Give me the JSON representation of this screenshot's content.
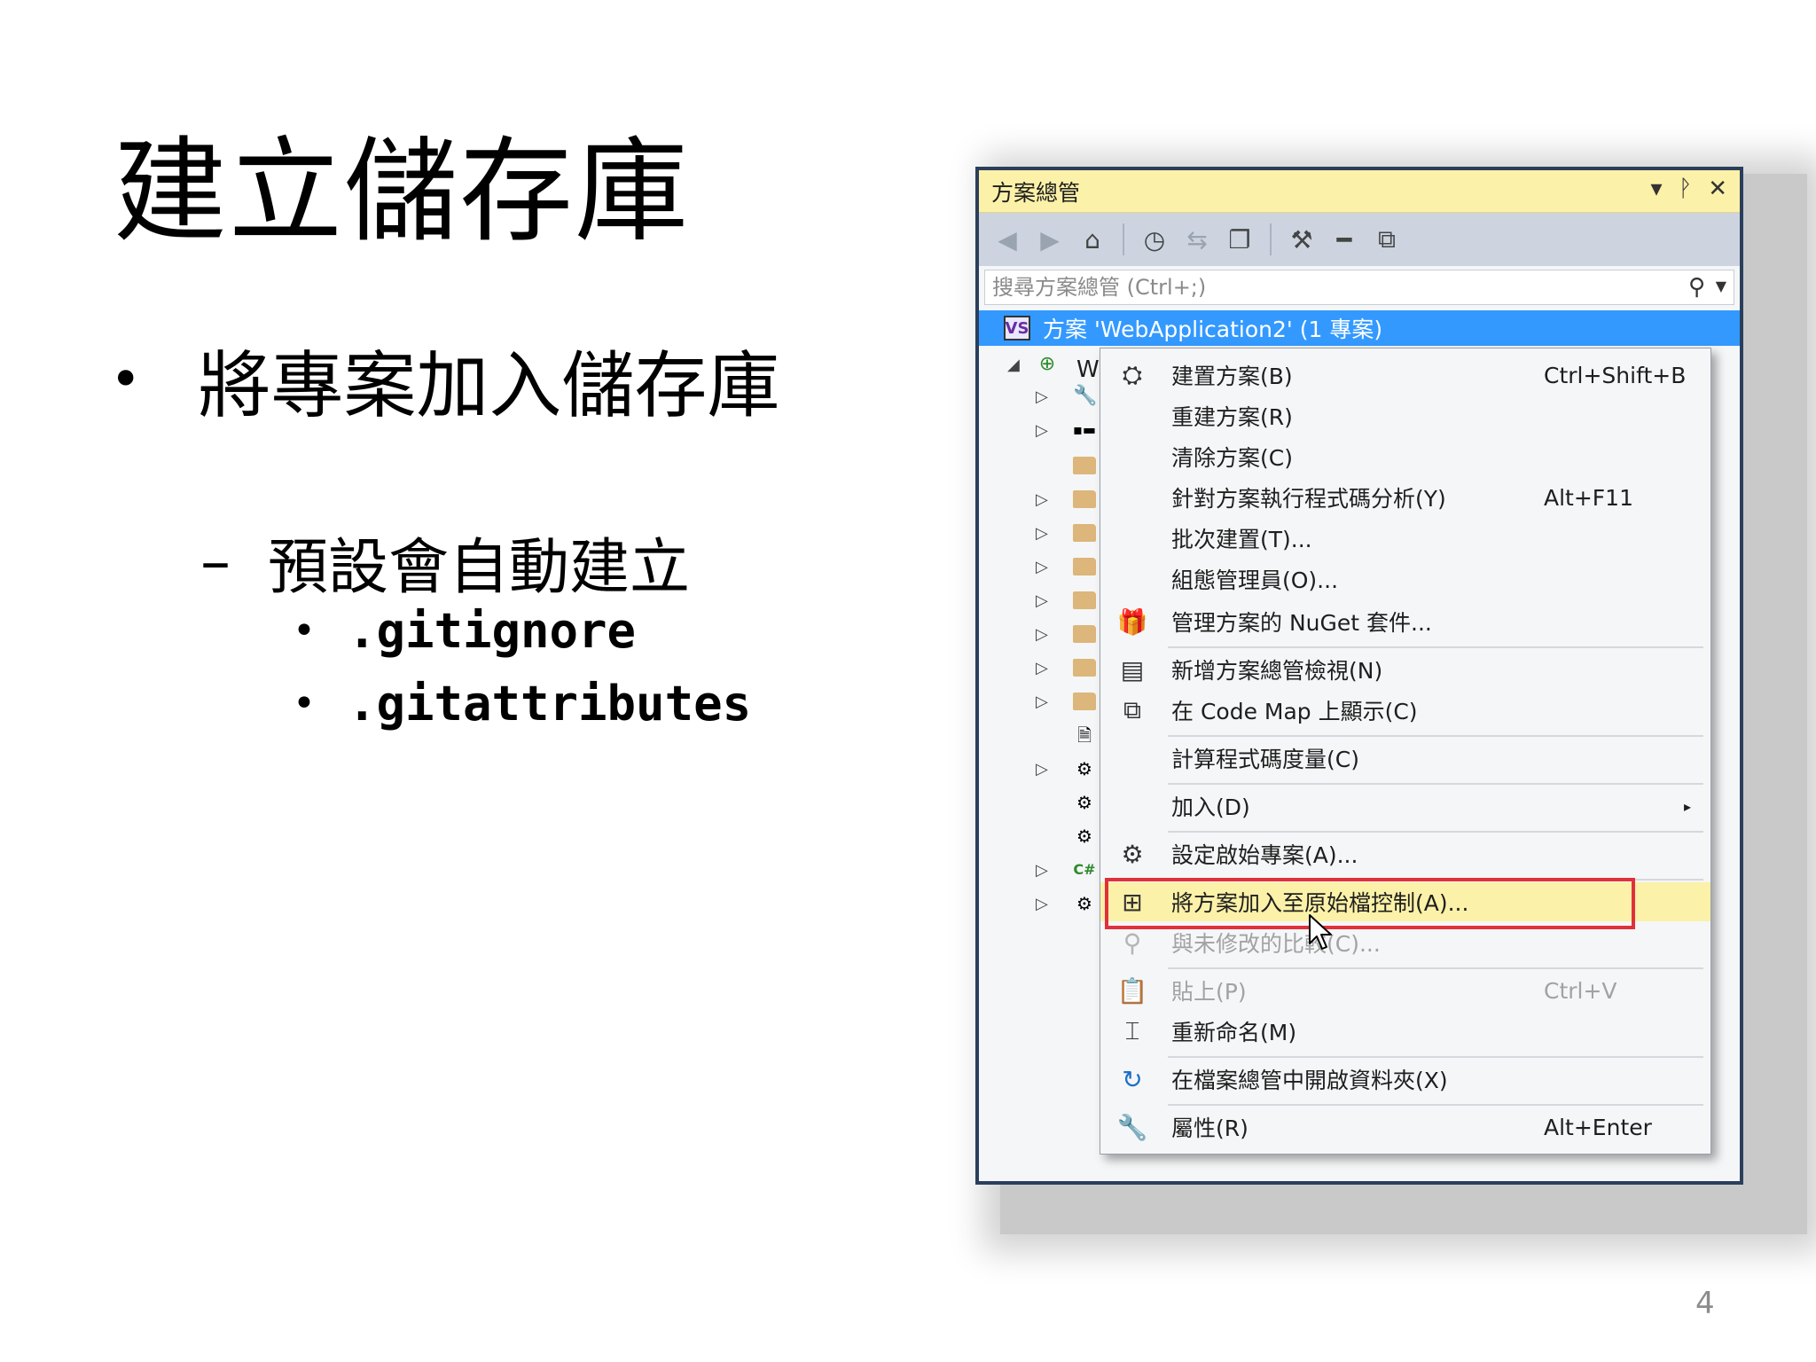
{
  "slide": {
    "title": "建立儲存庫",
    "bullet1": "將專案加入儲存庫",
    "bullet2": "預設會自動建立",
    "bullet3a": ".gitignore",
    "bullet3b": ".gitattributes",
    "page_number": "4",
    "bullet_glyph": "•",
    "dash_glyph": "–"
  },
  "solution_explorer": {
    "title": "方案總管",
    "title_buttons": {
      "dropdown": "▾",
      "pin": "ᚹ",
      "close": "✕"
    },
    "search_placeholder": "搜尋方案總管 (Ctrl+;)",
    "root_label": "方案 'WebApplication2' (1 專案)",
    "project_label_partial": "W",
    "toolbar_icons": [
      "back-icon",
      "forward-icon",
      "home-icon",
      "history-icon",
      "sync-icon",
      "collapse-all-icon",
      "properties-icon",
      "pending-changes-icon",
      "code-map-icon"
    ],
    "tree_rows": [
      {
        "icon": "web-project-icon",
        "expander": "open"
      },
      {
        "icon": "wrench-icon",
        "expander": "closed"
      },
      {
        "icon": "references-icon",
        "expander": "closed"
      },
      {
        "icon": "folder-icon",
        "expander": "none"
      },
      {
        "icon": "folder-icon",
        "expander": "closed"
      },
      {
        "icon": "folder-icon",
        "expander": "closed"
      },
      {
        "icon": "folder-icon",
        "expander": "closed"
      },
      {
        "icon": "folder-icon",
        "expander": "closed"
      },
      {
        "icon": "folder-icon",
        "expander": "closed"
      },
      {
        "icon": "folder-icon",
        "expander": "closed"
      },
      {
        "icon": "folder-icon",
        "expander": "closed"
      },
      {
        "icon": "file-icon",
        "expander": "none"
      },
      {
        "icon": "config-file-icon",
        "expander": "closed"
      },
      {
        "icon": "config-file-icon",
        "expander": "none"
      },
      {
        "icon": "config-file-icon",
        "expander": "none"
      },
      {
        "icon": "csharp-file-icon",
        "expander": "closed"
      },
      {
        "icon": "config-file-icon",
        "expander": "closed"
      }
    ]
  },
  "context_menu": {
    "items": [
      {
        "icon": "build-icon",
        "label": "建置方案(B)",
        "shortcut": "Ctrl+Shift+B"
      },
      {
        "icon": "",
        "label": "重建方案(R)",
        "shortcut": ""
      },
      {
        "icon": "",
        "label": "清除方案(C)",
        "shortcut": ""
      },
      {
        "icon": "",
        "label": "針對方案執行程式碼分析(Y)",
        "shortcut": "Alt+F11"
      },
      {
        "icon": "",
        "label": "批次建置(T)...",
        "shortcut": ""
      },
      {
        "icon": "",
        "label": "組態管理員(O)...",
        "shortcut": ""
      },
      {
        "icon": "nuget-icon",
        "label": "管理方案的 NuGet 套件...",
        "shortcut": ""
      },
      {
        "icon": "new-view-icon",
        "label": "新增方案總管檢視(N)",
        "shortcut": ""
      },
      {
        "icon": "code-map-icon",
        "label": "在 Code Map 上顯示(C)",
        "shortcut": ""
      },
      {
        "icon": "",
        "label": "計算程式碼度量(C)",
        "shortcut": ""
      },
      {
        "icon": "",
        "label": "加入(D)",
        "shortcut": "",
        "submenu": "▸"
      },
      {
        "icon": "gear-icon",
        "label": "設定啟始專案(A)...",
        "shortcut": ""
      },
      {
        "icon": "add-source-control-icon",
        "label": "將方案加入至原始檔控制(A)...",
        "shortcut": "",
        "highlighted": true
      },
      {
        "icon": "compare-icon",
        "label": "與未修改的比較(C)...",
        "shortcut": "",
        "disabled": true
      },
      {
        "icon": "paste-icon",
        "label": "貼上(P)",
        "shortcut": "Ctrl+V",
        "disabled": true
      },
      {
        "icon": "rename-icon",
        "label": "重新命名(M)",
        "shortcut": ""
      },
      {
        "icon": "open-folder-icon",
        "label": "在檔案總管中開啟資料夾(X)",
        "shortcut": ""
      },
      {
        "icon": "wrench-icon",
        "label": "屬性(R)",
        "shortcut": "Alt+Enter"
      }
    ]
  },
  "colors": {
    "titlebar": "#fcf1a8",
    "toolbar": "#cdd4e0",
    "selection": "#3399ff",
    "highlight_border": "#e0313b",
    "frame": "#2b3f5c"
  }
}
